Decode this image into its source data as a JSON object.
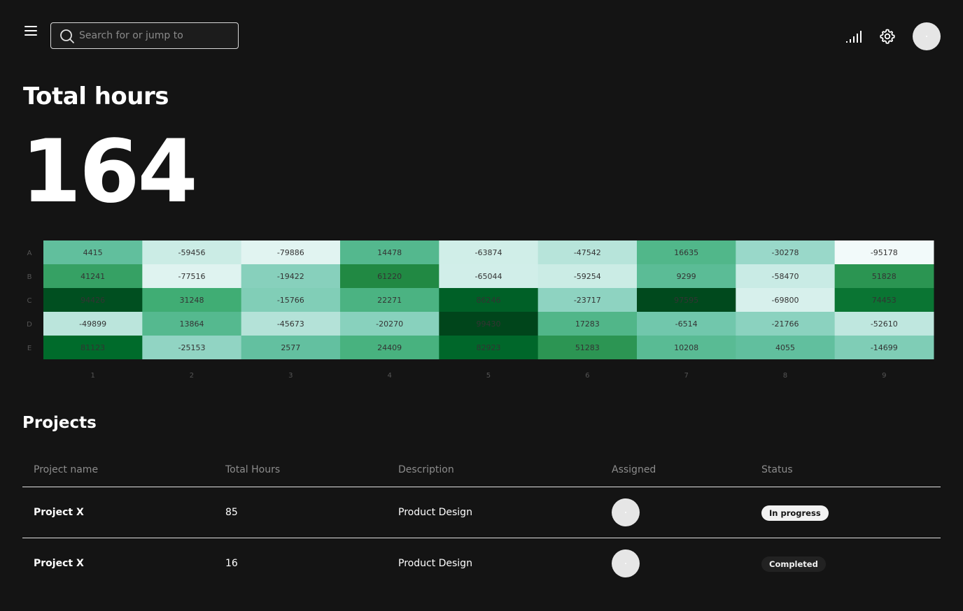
{
  "header": {
    "search_placeholder": "Search for or jump to",
    "icons": [
      "menu-icon",
      "search-icon",
      "signal-icon",
      "gear-icon",
      "avatar"
    ]
  },
  "summary": {
    "title": "Total hours",
    "value": "164"
  },
  "chart_data": {
    "type": "heatmap",
    "rows": [
      "A",
      "B",
      "C",
      "D",
      "E"
    ],
    "columns": [
      "1",
      "2",
      "3",
      "4",
      "5",
      "6",
      "7",
      "8",
      "9"
    ],
    "values": [
      [
        4415,
        -59456,
        -79886,
        14478,
        -63874,
        -47542,
        16635,
        -30278,
        -95178
      ],
      [
        41241,
        -77516,
        -19422,
        61220,
        -65044,
        -59254,
        9299,
        -58470,
        51828
      ],
      [
        94426,
        31248,
        -15766,
        22271,
        86246,
        -23717,
        97595,
        -69800,
        74453
      ],
      [
        -49899,
        13864,
        -45673,
        -20270,
        99430,
        17283,
        -6514,
        -21766,
        -52610
      ],
      [
        81123,
        -25153,
        2577,
        24409,
        82923,
        51283,
        10208,
        4055,
        -14699
      ]
    ],
    "color_scale": [
      "#f7fcfd",
      "#00441b"
    ],
    "range": [
      -100000,
      100000
    ]
  },
  "projects": {
    "title": "Projects",
    "columns": [
      "Project name",
      "Total Hours",
      "Description",
      "Assigned",
      "Status"
    ],
    "rows": [
      {
        "name": "Project X",
        "hours": "85",
        "description": "Product Design",
        "status": "In progress"
      },
      {
        "name": "Project X",
        "hours": "16",
        "description": "Product Design",
        "status": "Completed"
      }
    ]
  }
}
